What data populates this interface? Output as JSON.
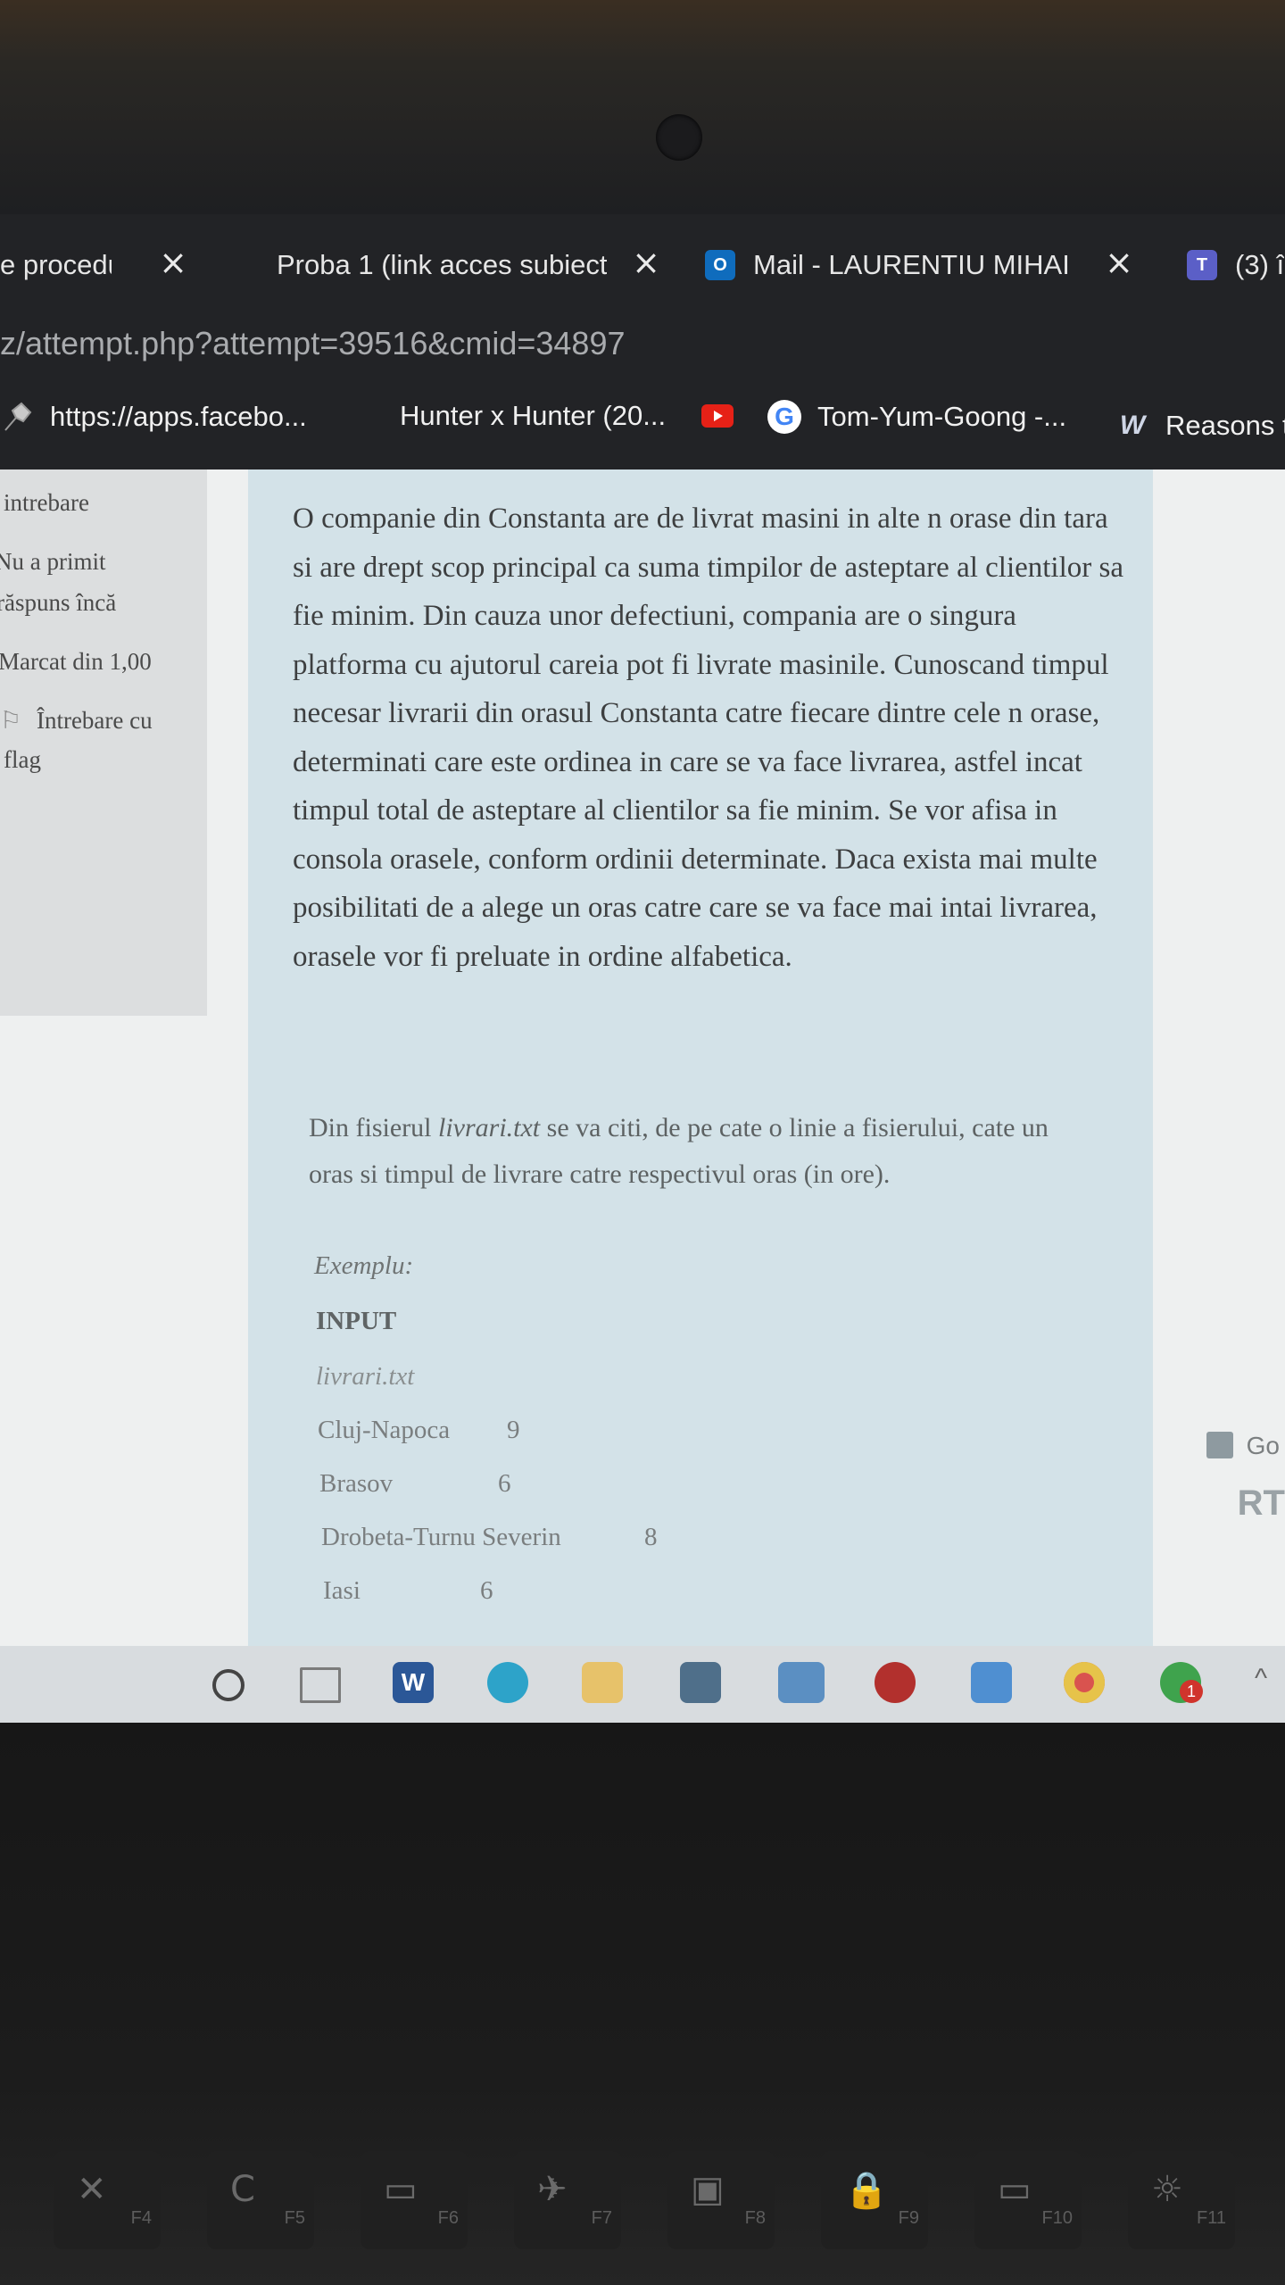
{
  "tabs": [
    {
      "title": "e procedu",
      "close": "×"
    },
    {
      "title": "Proba 1 (link acces subiect",
      "close": "×"
    },
    {
      "title": "Mail - LAURENTIU MIHAI",
      "close": "×",
      "icon": "outlook-icon",
      "icon_color": "#0f6cbd"
    },
    {
      "title": "(3) î",
      "icon": "teams-icon",
      "icon_color": "#5b5fc7"
    }
  ],
  "url": "z/attempt.php?attempt=39516&cmid=34897",
  "bookmarks": [
    {
      "label": "https://apps.facebo...",
      "icon": "pin-icon"
    },
    {
      "label": "Hunter x Hunter (20...",
      "icon": "youtube-icon",
      "icon_color": "#e62117"
    },
    {
      "label": "Tom-Yum-Goong -...",
      "icon": "google-icon"
    },
    {
      "label": "Reasons t",
      "icon": "w-icon"
    }
  ],
  "question_info": {
    "line1": "intrebare",
    "line2": "Nu a primit",
    "line3": "răspuns încă",
    "line4": "Marcat din 1,00",
    "flag_line1": "Întrebare cu",
    "flag_line2": "flag"
  },
  "question": {
    "paragraph1": "O companie din Constanta are de livrat masini in alte n orase din tara si are drept scop principal ca suma timpilor de asteptare al clientilor sa fie minim. Din cauza unor defectiuni, compania are o singura platforma cu ajutorul careia pot fi livrate masinile. Cunoscand timpul necesar livrarii din orasul Constanta catre fiecare dintre cele n orase, determinati care este ordinea in care se va face livrarea, astfel incat timpul total de asteptare al clientilor sa fie minim. Se vor afisa in consola orasele, conform ordinii determinate. Daca exista mai multe posibilitati de a alege un oras catre care se va face mai intai livrarea, orasele vor fi preluate in ordine alfabetica.",
    "paragraph2_before": "Din fisierul ",
    "paragraph2_file": "livrari.txt",
    "paragraph2_after": " se va citi, de pe cate o linie a fisierului, cate un oras si timpul de livrare catre respectivul oras (in ore).",
    "example_label": "Exemplu:",
    "input_label": "INPUT",
    "file_label": "livrari.txt",
    "rows": [
      {
        "city": "Cluj-Napoca",
        "time": "9"
      },
      {
        "city": "Brasov",
        "time": "6"
      },
      {
        "city": "Drobeta-Turnu Severin",
        "time": "8"
      },
      {
        "city": "Iasi",
        "time": "6"
      }
    ]
  },
  "right_edge": {
    "go": "Go",
    "rt": "RT"
  },
  "taskbar": {
    "icons": [
      "search-circle-icon",
      "task-view-icon",
      "word-icon",
      "edge-icon",
      "file-explorer-icon",
      "store-icon",
      "mail-icon",
      "app-red-icon",
      "zoom-icon",
      "chrome-icon",
      "app-badge-icon"
    ],
    "badge": "1",
    "chevron": "^"
  },
  "keys": [
    {
      "glyph": "✕",
      "label": "F4"
    },
    {
      "glyph": "C",
      "label": "F5"
    },
    {
      "glyph": "▭",
      "label": "F6"
    },
    {
      "glyph": "✈",
      "label": "F7"
    },
    {
      "glyph": "▣",
      "label": "F8"
    },
    {
      "glyph": "🔒",
      "label": "F9"
    },
    {
      "glyph": "▭",
      "label": "F10"
    },
    {
      "glyph": "☼",
      "label": "F11"
    }
  ]
}
